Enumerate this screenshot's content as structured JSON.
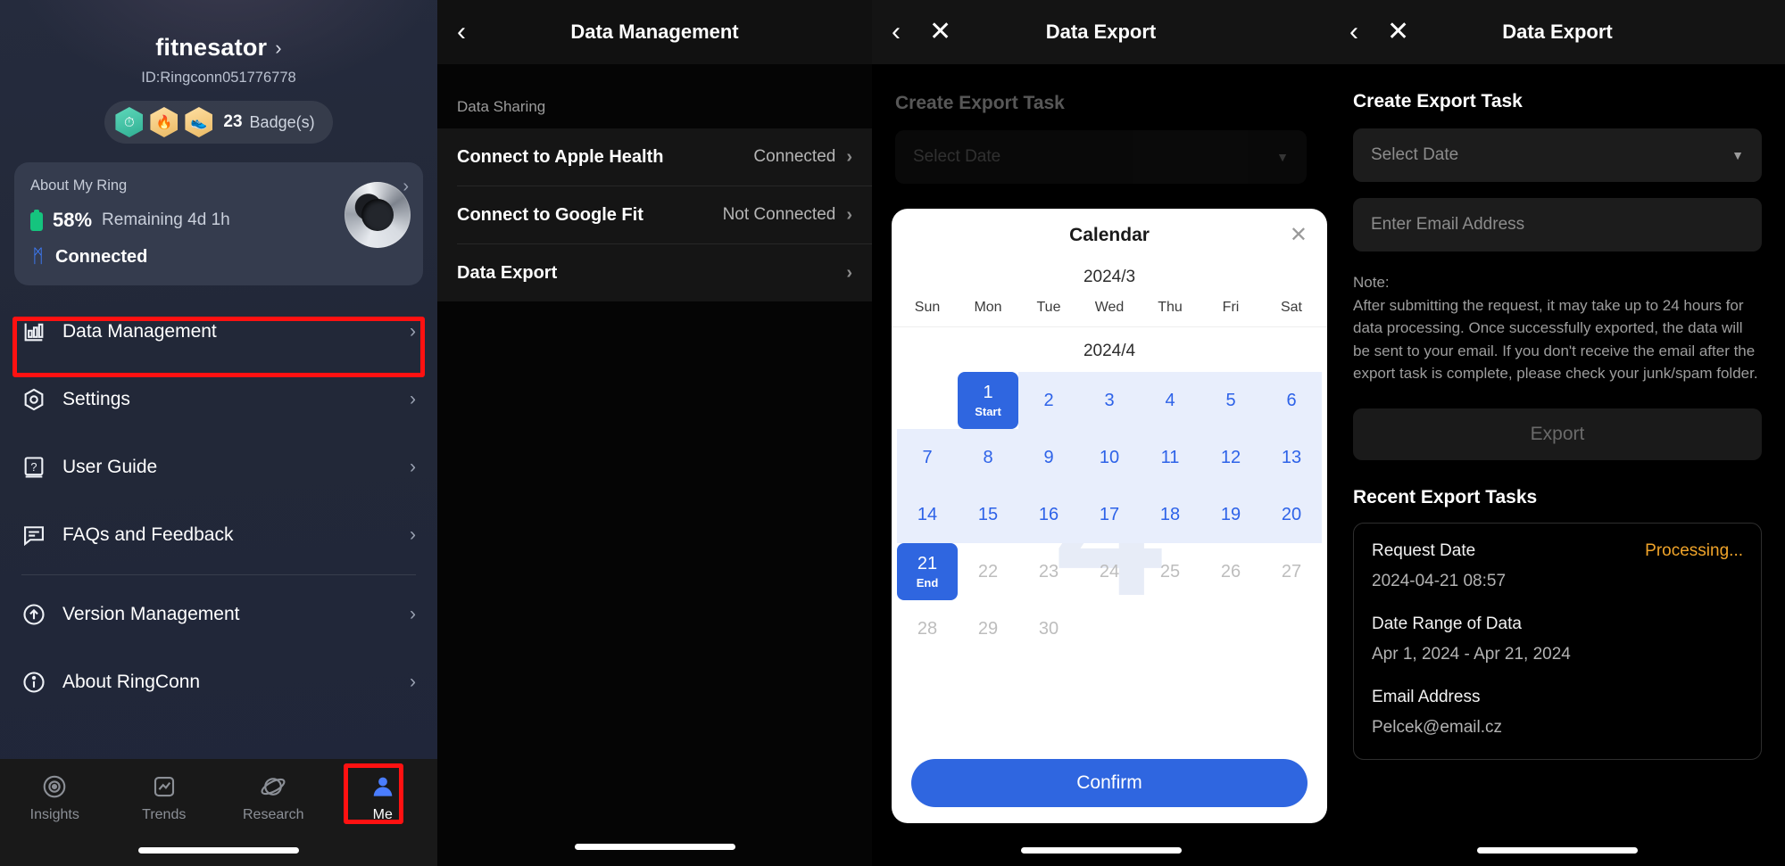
{
  "profile": {
    "username": "fitnesator",
    "chevron": "›",
    "user_id": "ID:Ringconn051776778",
    "badge_count": "23",
    "badge_word": "Badge(s)",
    "badges": [
      {
        "name": "badge-clock-icon",
        "glyph": "⏱",
        "color": "#46c9a8"
      },
      {
        "name": "badge-flame-icon",
        "glyph": "🔥",
        "color": "#f3c97a"
      },
      {
        "name": "badge-shoe-icon",
        "glyph": "👟",
        "color": "#f3c97a"
      }
    ]
  },
  "ring_card": {
    "title": "About My Ring",
    "chevron": "›",
    "battery_pct": "58%",
    "battery_remaining": "Remaining 4d 1h",
    "bluetooth_glyph": "ᛗ",
    "connection_status": "Connected"
  },
  "menu": {
    "items": [
      {
        "label": "Data Management",
        "icon": "bar-chart-icon",
        "chevron": "›",
        "highlighted": true
      },
      {
        "label": "Settings",
        "icon": "gear-icon",
        "chevron": "›",
        "highlighted": false
      },
      {
        "label": "User Guide",
        "icon": "book-question-icon",
        "chevron": "›",
        "highlighted": false
      },
      {
        "label": "FAQs and Feedback",
        "icon": "chat-bubble-icon",
        "chevron": "›",
        "highlighted": false
      },
      {
        "label": "Version Management",
        "icon": "arrow-up-circle-icon",
        "chevron": "›",
        "highlighted": false
      },
      {
        "label": "About RingConn",
        "icon": "info-circle-icon",
        "chevron": "›",
        "highlighted": false
      }
    ]
  },
  "tabbar": {
    "tabs": [
      {
        "label": "Insights",
        "icon": "insights-icon",
        "active": false
      },
      {
        "label": "Trends",
        "icon": "trends-icon",
        "active": false
      },
      {
        "label": "Research",
        "icon": "research-icon",
        "active": false
      },
      {
        "label": "Me",
        "icon": "person-icon",
        "active": true
      }
    ]
  },
  "data_management": {
    "title": "Data Management",
    "back_glyph": "‹",
    "section_label": "Data Sharing",
    "rows": [
      {
        "label": "Connect to Apple Health",
        "value": "Connected",
        "chevron": "›"
      },
      {
        "label": "Connect to Google Fit",
        "value": "Not Connected",
        "chevron": "›"
      },
      {
        "label": "Data Export",
        "value": "",
        "chevron": "›"
      }
    ]
  },
  "data_export_calendar": {
    "title": "Data Export",
    "back_glyph": "‹",
    "close_glyph": "✕",
    "section_title": "Create Export Task",
    "select_date_placeholder": "Select Date",
    "caret_glyph": "▼",
    "calendar": {
      "title": "Calendar",
      "close_glyph": "✕",
      "month_top": "2024/3",
      "weekdays": [
        "Sun",
        "Mon",
        "Tue",
        "Wed",
        "Thu",
        "Fri",
        "Sat"
      ],
      "month_label": "2024/4",
      "watermark": "4",
      "leading_blanks": 1,
      "days": [
        {
          "d": "1",
          "state": "start",
          "sub": "Start"
        },
        {
          "d": "2",
          "state": "inrange",
          "sub": ""
        },
        {
          "d": "3",
          "state": "inrange",
          "sub": ""
        },
        {
          "d": "4",
          "state": "inrange",
          "sub": ""
        },
        {
          "d": "5",
          "state": "inrange",
          "sub": ""
        },
        {
          "d": "6",
          "state": "inrange",
          "sub": ""
        },
        {
          "d": "7",
          "state": "inrange",
          "sub": ""
        },
        {
          "d": "8",
          "state": "inrange",
          "sub": ""
        },
        {
          "d": "9",
          "state": "inrange",
          "sub": ""
        },
        {
          "d": "10",
          "state": "inrange",
          "sub": ""
        },
        {
          "d": "11",
          "state": "inrange",
          "sub": ""
        },
        {
          "d": "12",
          "state": "inrange",
          "sub": ""
        },
        {
          "d": "13",
          "state": "inrange",
          "sub": ""
        },
        {
          "d": "14",
          "state": "inrange",
          "sub": ""
        },
        {
          "d": "15",
          "state": "inrange",
          "sub": ""
        },
        {
          "d": "16",
          "state": "inrange",
          "sub": ""
        },
        {
          "d": "17",
          "state": "inrange",
          "sub": ""
        },
        {
          "d": "18",
          "state": "inrange",
          "sub": ""
        },
        {
          "d": "19",
          "state": "inrange",
          "sub": ""
        },
        {
          "d": "20",
          "state": "inrange",
          "sub": ""
        },
        {
          "d": "21",
          "state": "end",
          "sub": "End"
        },
        {
          "d": "22",
          "state": "plain",
          "sub": ""
        },
        {
          "d": "23",
          "state": "plain",
          "sub": ""
        },
        {
          "d": "24",
          "state": "plain",
          "sub": ""
        },
        {
          "d": "25",
          "state": "plain",
          "sub": ""
        },
        {
          "d": "26",
          "state": "plain",
          "sub": ""
        },
        {
          "d": "27",
          "state": "plain",
          "sub": ""
        },
        {
          "d": "28",
          "state": "plain",
          "sub": ""
        },
        {
          "d": "29",
          "state": "plain",
          "sub": ""
        },
        {
          "d": "30",
          "state": "plain",
          "sub": ""
        }
      ],
      "confirm_label": "Confirm"
    }
  },
  "data_export_detail": {
    "title": "Data Export",
    "back_glyph": "‹",
    "close_glyph": "✕",
    "section_title": "Create Export Task",
    "select_date_placeholder": "Select Date",
    "caret_glyph": "▼",
    "email_placeholder": "Enter Email Address",
    "note_heading": "Note:",
    "note_body": "After submitting the request, it may take up to 24 hours for data processing. Once successfully exported, the data will be sent to your email. If you don't receive the email after the export task is complete, please check your junk/spam folder.",
    "export_label": "Export",
    "recent_title": "Recent Export Tasks",
    "task": {
      "request_date_label": "Request Date",
      "status": "Processing...",
      "status_color": "#f0a42a",
      "request_date_value": "2024-04-21 08:57",
      "date_range_label": "Date Range of Data",
      "date_range_value": "Apr 1, 2024 - Apr 21, 2024",
      "email_label": "Email Address",
      "email_value": "Pelcek@email.cz"
    }
  }
}
